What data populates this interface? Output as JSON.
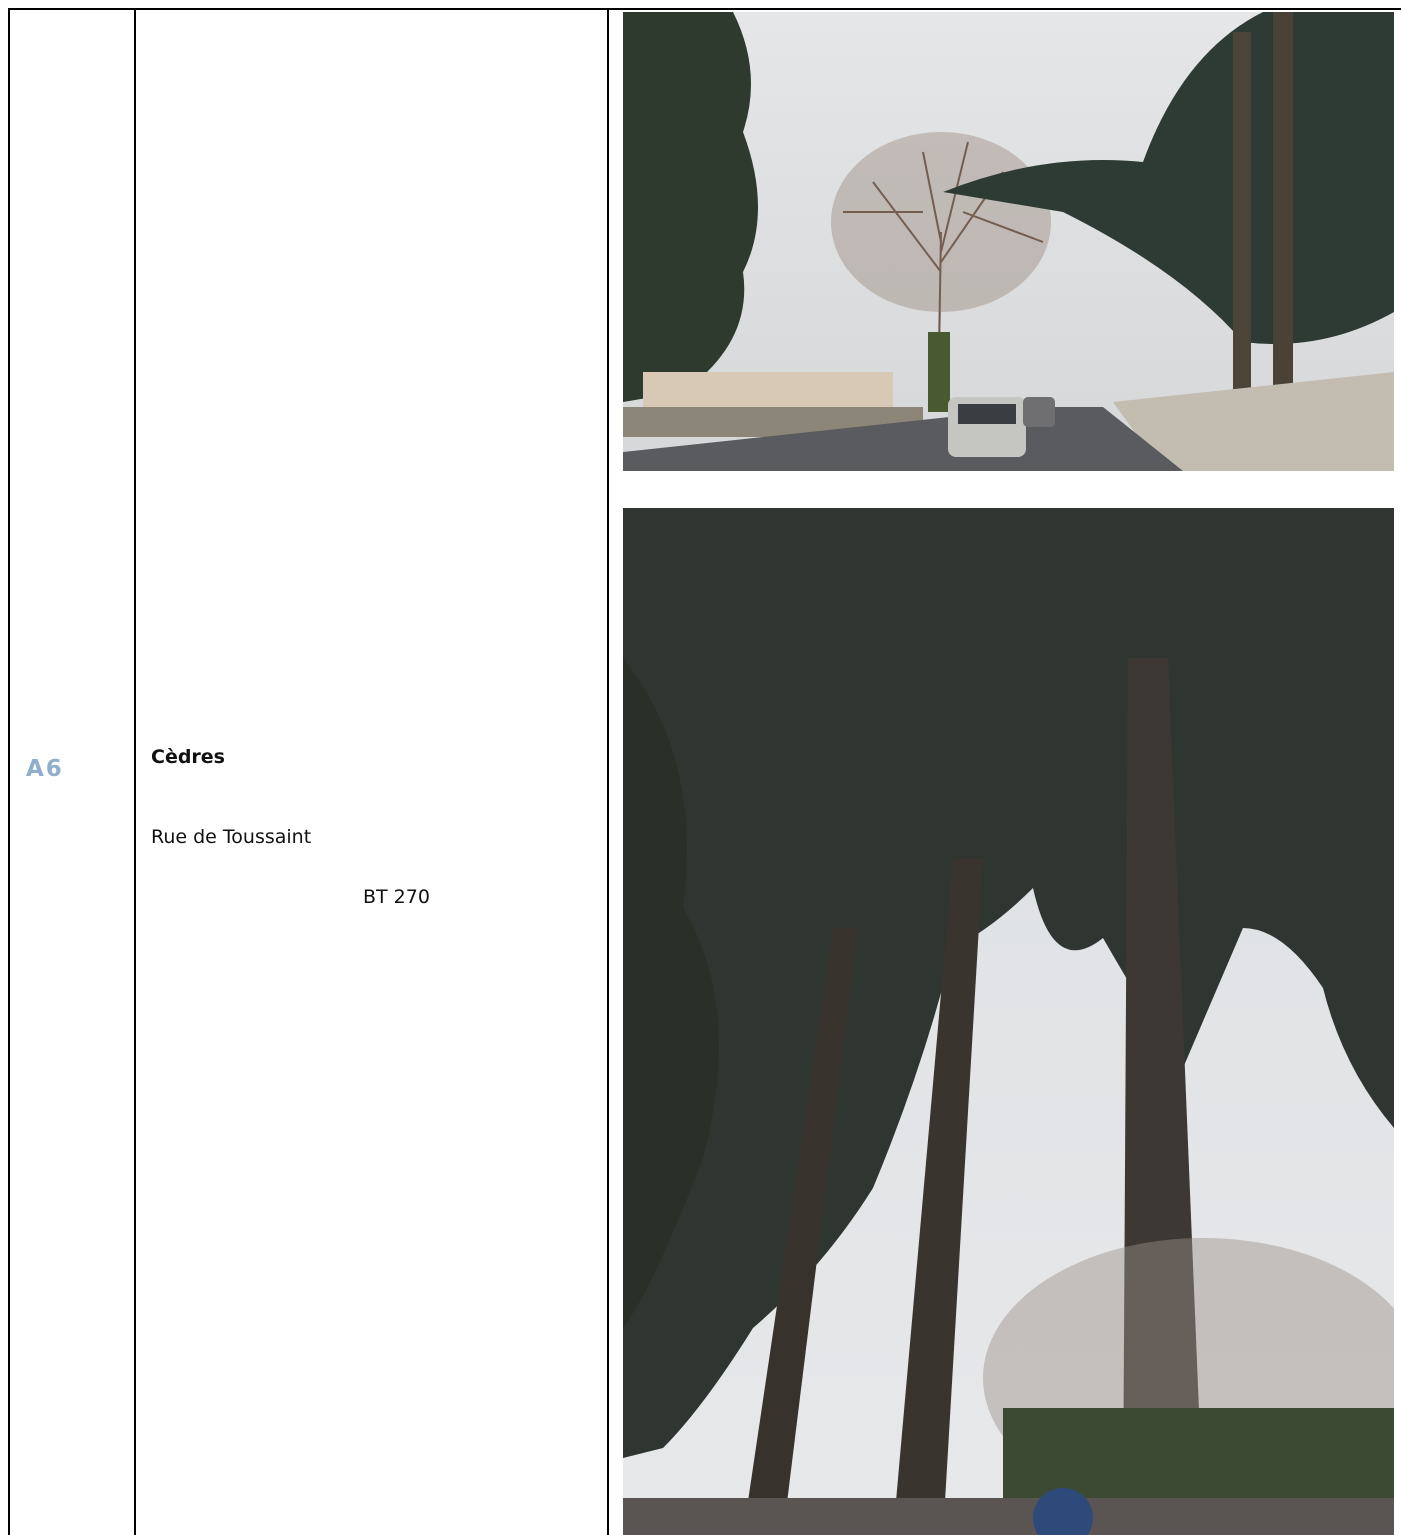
{
  "row": {
    "code": "A6",
    "title": "Cèdres",
    "street": "Rue de Toussaint",
    "parcel": "BT 270"
  }
}
